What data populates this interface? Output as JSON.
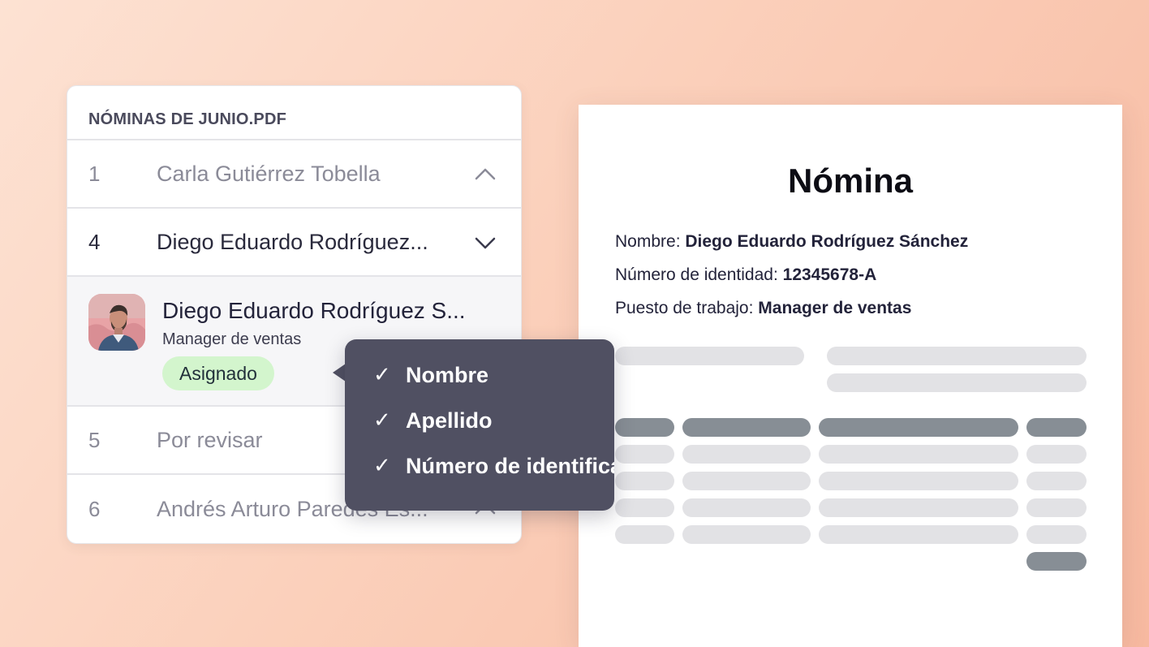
{
  "list_panel": {
    "header": "NÓMINAS DE JUNIO.PDF",
    "rows": [
      {
        "number": "1",
        "name": "Carla Gutiérrez Tobella",
        "icon": "chevron-up-icon"
      },
      {
        "number": "4",
        "name": "Diego Eduardo Rodríguez...",
        "icon": "chevron-down-icon"
      }
    ],
    "expanded_card": {
      "name": "Diego Eduardo Rodríguez S...",
      "role": "Manager de ventas",
      "status": "Asignado",
      "status_color": "#d3f5cd",
      "avatar_icon": "person-avatar-icon"
    },
    "rows_after": [
      {
        "number": "5",
        "name": "Por revisar"
      },
      {
        "number": "6",
        "name": "Andrés Arturo Paredes Es...",
        "icon": "chevron-up-icon"
      }
    ]
  },
  "tooltip": {
    "items": [
      {
        "check": "✓",
        "label": "Nombre"
      },
      {
        "check": "✓",
        "label": "Apellido"
      },
      {
        "check": "✓",
        "label": "Número de identificación"
      }
    ],
    "background": "#505062"
  },
  "document": {
    "title": "Nómina",
    "fields": [
      {
        "label": "Nombre: ",
        "value": "Diego Eduardo Rodríguez Sánchez"
      },
      {
        "label": "Número de identidad: ",
        "value": "12345678-A"
      },
      {
        "label": "Puesto de trabajo: ",
        "value": "Manager de ventas"
      }
    ]
  },
  "colors": {
    "background_start": "#fde2d3",
    "background_end": "#f7b9a0",
    "text_dark": "#23233a",
    "text_muted": "#8b8b98",
    "placeholder_light": "#e2e2e5",
    "placeholder_dark": "#878e95"
  }
}
